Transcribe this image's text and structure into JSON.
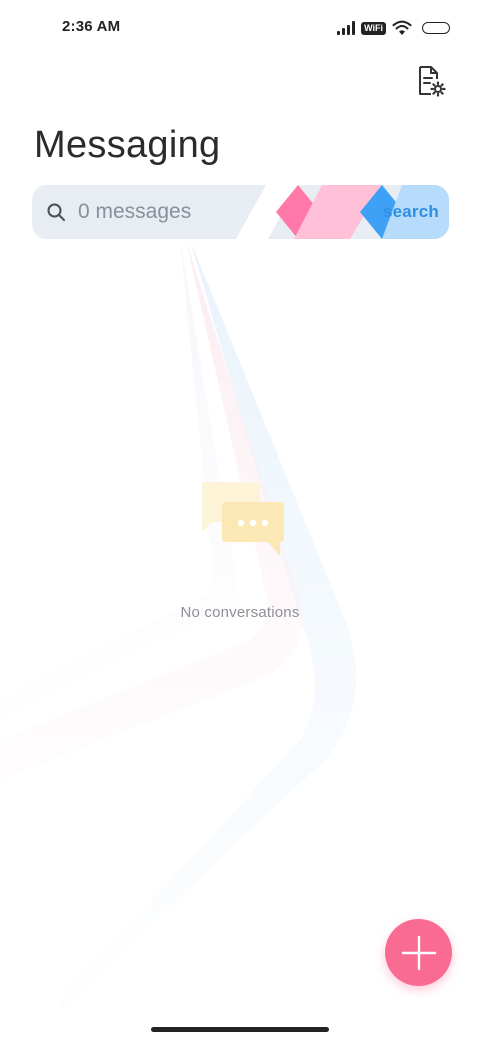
{
  "status_bar": {
    "time": "2:36 AM",
    "wifi_badge": "WiFi",
    "icons": [
      "signal-icon",
      "wifi-badge-icon",
      "wifi-icon",
      "battery-icon"
    ]
  },
  "header": {
    "title": "Messaging",
    "settings_icon": "document-gear-icon"
  },
  "search": {
    "placeholder": "0 messages",
    "button_label": "search",
    "icon": "search-icon"
  },
  "empty_state": {
    "message": "No conversations",
    "icon": "chat-bubbles-icon"
  },
  "fab": {
    "icon": "plus-icon"
  },
  "colors": {
    "accent_pink": "#f96b93",
    "search_blue": "#2e8fe6",
    "search_bg": "#e8ecf3",
    "deco_pink": "#ff78a8",
    "deco_light_pink": "#ffc0d8",
    "deco_blue": "#3fa1f5",
    "deco_light_blue": "#b7dcfb",
    "empty_yellow": "#fce8b5"
  }
}
